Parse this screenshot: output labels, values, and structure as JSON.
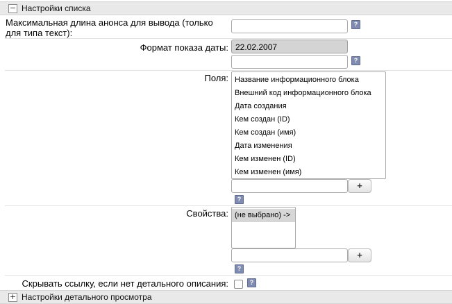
{
  "list_settings": {
    "toggle": "−",
    "title": "Настройки списка",
    "preview_max_length": {
      "label": "Максимальная длина анонса для вывода (только для типа текст):",
      "value": ""
    },
    "date_format": {
      "label": "Формат показа даты:",
      "selected": "22.02.2007",
      "custom_value": ""
    },
    "fields": {
      "label": "Поля:",
      "options": [
        "Название информационного блока",
        "Внешний код информационного блока",
        "Дата создания",
        "Кем создан (ID)",
        "Кем создан (имя)",
        "Дата изменения",
        "Кем изменен (ID)",
        "Кем изменен (имя)"
      ],
      "add_value": "",
      "add_button": "+"
    },
    "properties": {
      "label": "Свойства:",
      "options": [
        "(не выбрано) ->"
      ],
      "add_value": "",
      "add_button": "+"
    },
    "hide_link": {
      "label": "Скрывать ссылку, если нет детального описания:",
      "checked": false
    },
    "help_icon": "?"
  },
  "detail_settings": {
    "toggle": "+",
    "title": "Настройки детального просмотра"
  }
}
